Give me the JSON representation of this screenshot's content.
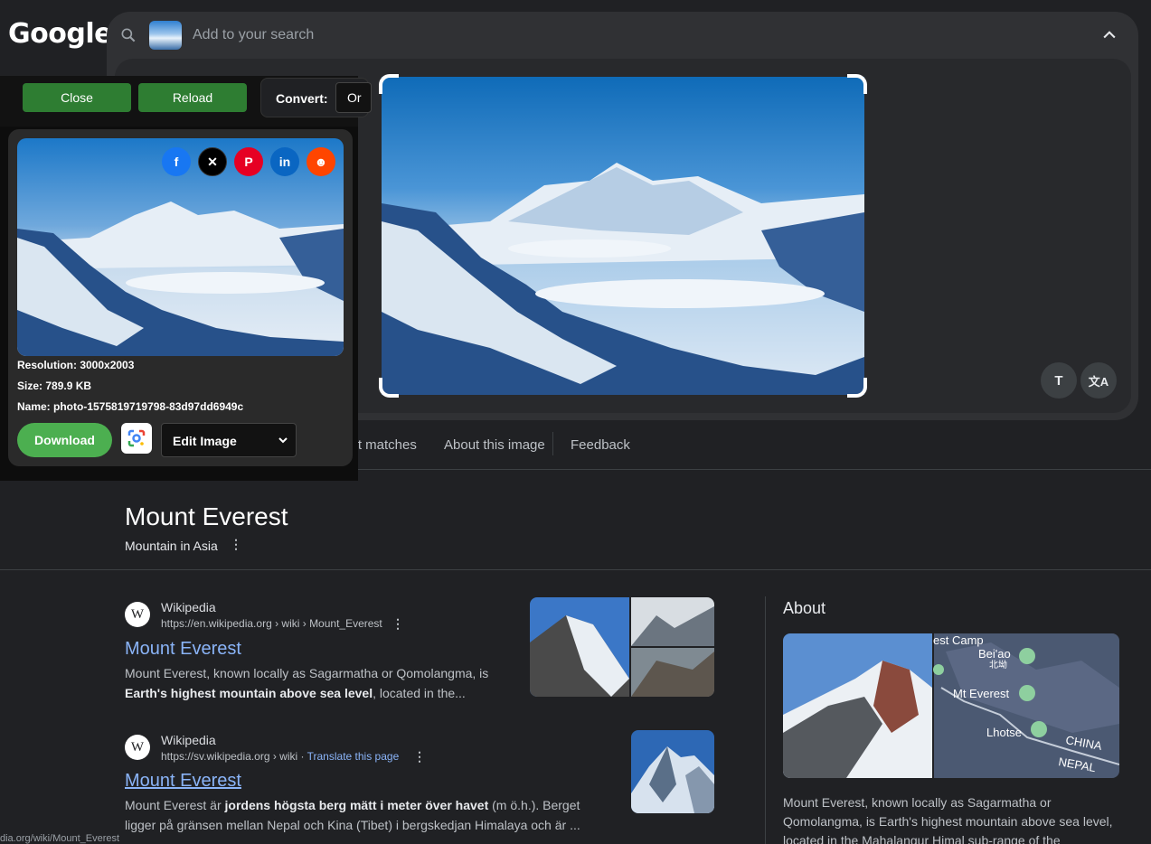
{
  "header": {
    "logo": "Google"
  },
  "search": {
    "placeholder": "Add to your search"
  },
  "tabs": {
    "exact_matches": "act matches",
    "about_image": "About this image",
    "feedback": "Feedback"
  },
  "overlay_buttons": {
    "text": "T",
    "translate": "文A"
  },
  "entity": {
    "title": "Mount Everest",
    "subtitle": "Mountain in Asia"
  },
  "results": [
    {
      "site": "Wikipedia",
      "url": "https://en.wikipedia.org › wiki › Mount_Everest",
      "title": "Mount Everest",
      "snippet_pre": "Mount Everest, known locally as Sagarmatha or Qomolangma, is ",
      "snippet_bold": "Earth's highest mountain above sea level",
      "snippet_post": ", located in the..."
    },
    {
      "site": "Wikipedia",
      "url": "https://sv.wikipedia.org › wiki",
      "translate": "Translate this page",
      "title": "Mount Everest",
      "snippet_pre": "Mount Everest är ",
      "snippet_bold": "jordens högsta berg mätt i meter över havet",
      "snippet_post": " (m ö.h.). Berget ligger på gränsen mellan Nepal och Kina (Tibet) i bergskedjan Himalaya och är ..."
    }
  ],
  "about": {
    "title": "About",
    "text": "Mount Everest, known locally as Sagarmatha or Qomolangma, is Earth's highest mountain above sea level, located in the Mahalangur Himal sub-range of the",
    "map_labels": {
      "camp": "est Camp",
      "beiao": "Bei'ao",
      "beiao_cn": "北坳",
      "mt_everest": "Mt Everest",
      "lhotse": "Lhotse",
      "china": "CHINA",
      "nepal": "NEPAL"
    }
  },
  "status_url": "dia.org/wiki/Mount_Everest",
  "extension": {
    "close": "Close",
    "reload": "Reload",
    "convert_label": "Convert:",
    "convert_value": "Or",
    "resolution": "Resolution: 3000x2003",
    "size": "Size: 789.9 KB",
    "name": "Name: photo-1575819719798-83d97dd6949c",
    "download": "Download",
    "edit_select": "Edit Image",
    "share_icons": [
      "facebook-icon",
      "x-icon",
      "pinterest-icon",
      "linkedin-icon",
      "reddit-icon"
    ]
  },
  "colors": {
    "link": "#8ab4f8",
    "green_button": "#2e7d32",
    "download": "#4caf50",
    "background": "#202124"
  }
}
